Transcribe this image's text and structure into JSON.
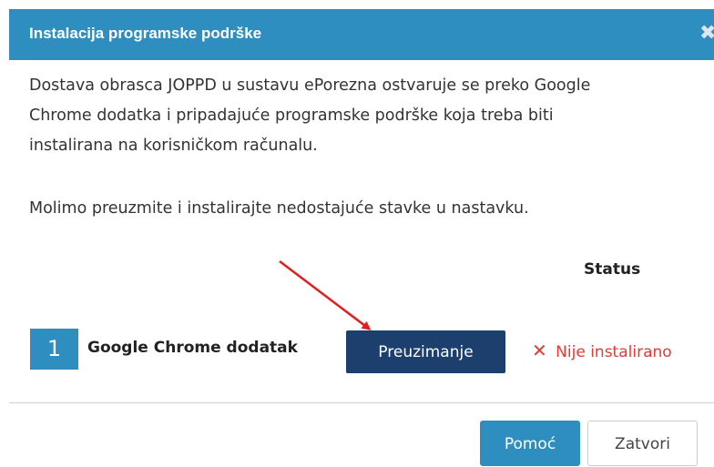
{
  "dialog": {
    "title": "Instalacija programske podrške",
    "close_symbol": "✖",
    "intro_line1": "Dostava obrasca JOPPD u sustavu ePorezna ostvaruje se preko Google",
    "intro_line2": "Chrome dodatka i pripadajuće programske podrške koja treba biti",
    "intro_line3": "instalirana na korisničkom računalu.",
    "intro_line4": "Molimo preuzmite i instalirajte nedostajuće stavke u nastavku."
  },
  "table": {
    "status_header": "Status",
    "items": [
      {
        "number": "1",
        "name": "Google Chrome dodatak",
        "action_label": "Preuzimanje",
        "status_icon": "✕",
        "status_text": "Nije instalirano"
      }
    ]
  },
  "footer": {
    "help_label": "Pomoć",
    "close_label": "Zatvori"
  },
  "colors": {
    "header_bg": "#2f8ec0",
    "download_button_bg": "#1c3f6e",
    "status_error": "#e53935",
    "annotation_arrow": "#e02020"
  },
  "icons": {
    "close": "close-icon",
    "status": "x-icon",
    "annotation": "red-arrow-annotation"
  }
}
